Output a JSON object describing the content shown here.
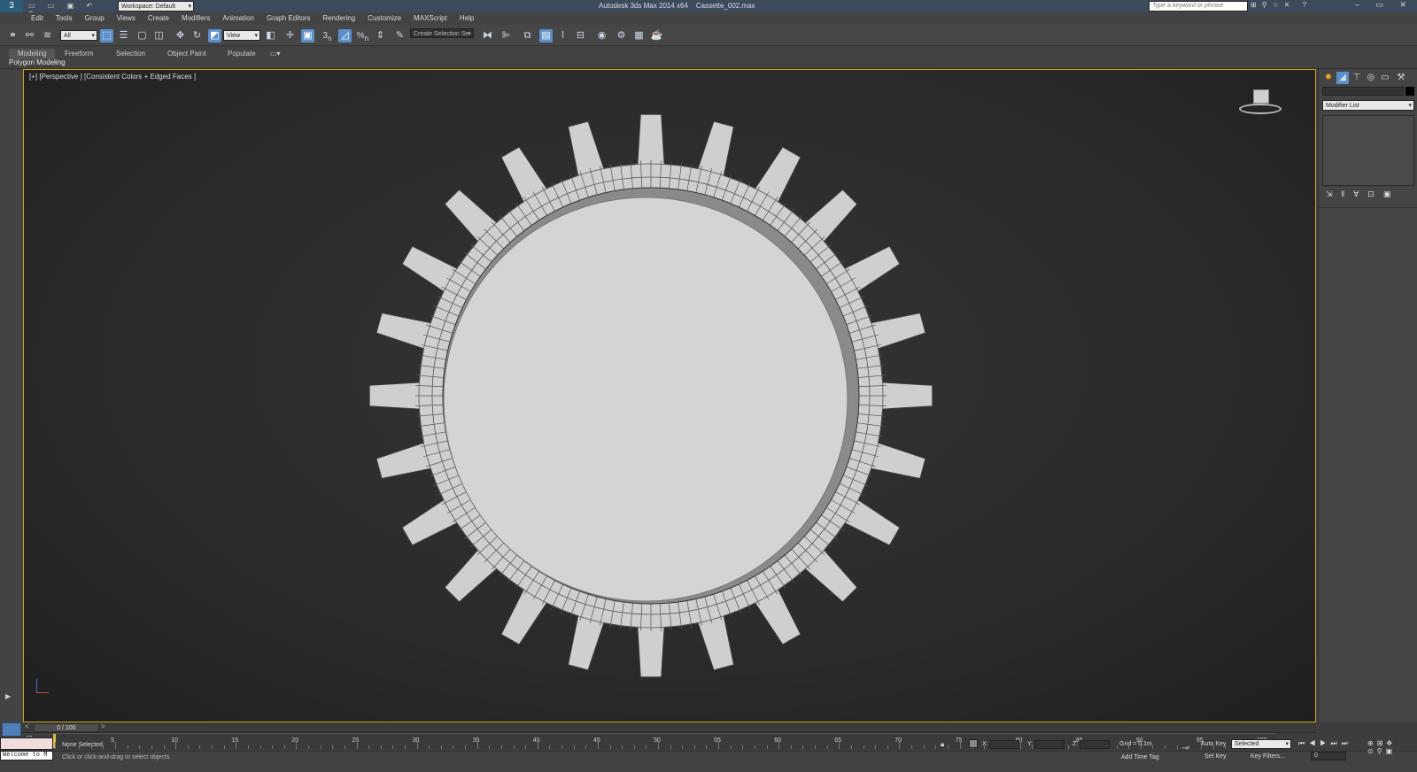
{
  "title": {
    "app": "Autodesk 3ds Max  2014 x64",
    "file": "Cassette_002.max",
    "workspace": "Workspace: Default",
    "search_placeholder": "Type a keyword or phrase"
  },
  "menu": [
    "Edit",
    "Tools",
    "Group",
    "Views",
    "Create",
    "Modifiers",
    "Animation",
    "Graph Editors",
    "Rendering",
    "Customize",
    "MAXScript",
    "Help"
  ],
  "toolbar": {
    "filter": "All",
    "refcoord": "View",
    "selection_set": "Create Selection Se",
    "snap_label": "3",
    "snap_sub": "n",
    "angle_label": "%",
    "angle_sub": "n"
  },
  "ribbon": {
    "tabs": [
      "Modeling",
      "Freeform",
      "Selection",
      "Object Paint",
      "Populate"
    ],
    "panel": "Polygon Modeling"
  },
  "viewport": {
    "label": "[+] [Perspective ] [Consistent Colors + Edged Faces ]"
  },
  "command_panel": {
    "modifier_list": "Modifier List"
  },
  "timeline": {
    "frame": "0 / 100",
    "ticks": [
      "5",
      "10",
      "15",
      "20",
      "25",
      "30",
      "35",
      "40",
      "45",
      "50",
      "55",
      "60",
      "65",
      "70",
      "75",
      "80",
      "85",
      "90",
      "95",
      "100"
    ]
  },
  "status": {
    "selection": "None Selected",
    "prompt": "Click or click-and-drag to select objects",
    "listener": "Welcome to M",
    "x_label": "X:",
    "y_label": "Y:",
    "z_label": "Z:",
    "grid": "Grid = 0.1m",
    "auto_key": "Auto Key",
    "set_key": "Set Key",
    "key_mode": "Selected",
    "key_filters": "Key Filters...",
    "add_time_tag": "Add Time Tag",
    "frame_value": "0"
  },
  "gear": {
    "teeth": 24
  }
}
